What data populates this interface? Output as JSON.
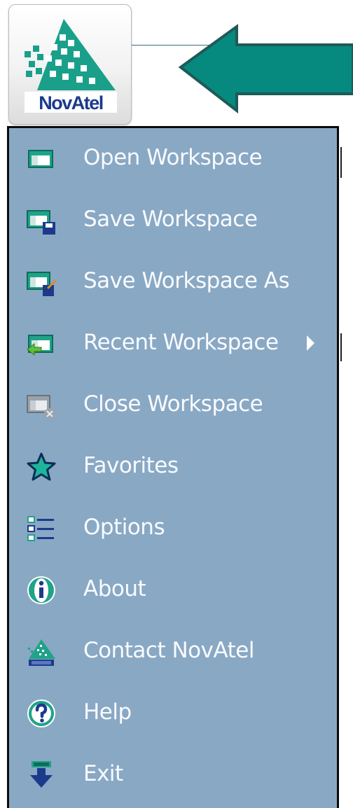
{
  "app_button": {
    "logo_text": "NovAtel",
    "colors": {
      "brand_green": "#1aa08a",
      "brand_navy": "#1c3a8c",
      "arrow": "#068a80"
    }
  },
  "menu": {
    "background": "#89a8c4",
    "items": [
      {
        "label": "Open Workspace",
        "icon": "open-workspace-icon"
      },
      {
        "label": "Save Workspace",
        "icon": "save-workspace-icon"
      },
      {
        "label": "Save Workspace As",
        "icon": "save-workspace-as-icon"
      },
      {
        "label": "Recent Workspace",
        "icon": "recent-workspace-icon",
        "has_submenu": true
      },
      {
        "label": "Close Workspace",
        "icon": "close-workspace-icon"
      },
      {
        "label": "Favorites",
        "icon": "star-icon"
      },
      {
        "label": "Options",
        "icon": "options-list-icon"
      },
      {
        "label": "About",
        "icon": "info-icon"
      },
      {
        "label": "Contact NovAtel",
        "icon": "novatel-logo-icon"
      },
      {
        "label": "Help",
        "icon": "help-icon"
      },
      {
        "label": "Exit",
        "icon": "exit-icon"
      }
    ]
  }
}
